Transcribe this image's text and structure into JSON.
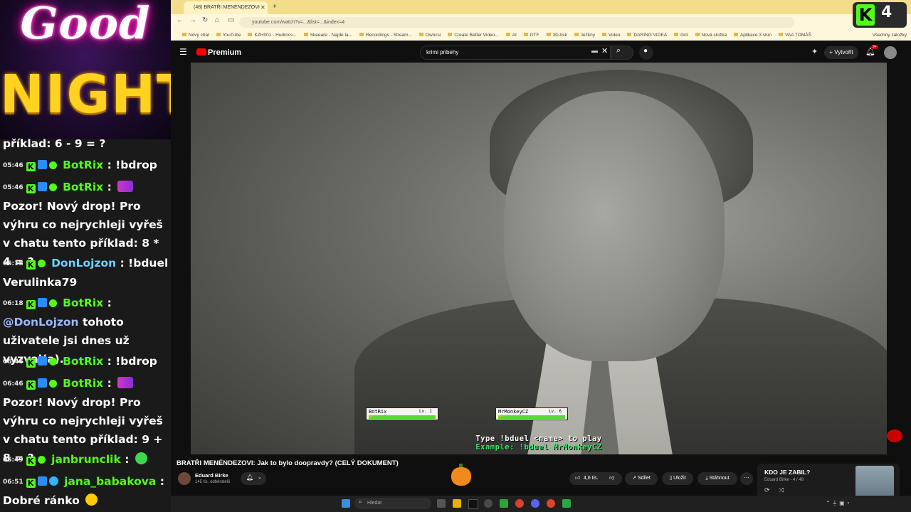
{
  "overlay": {
    "logo_good": "Good",
    "logo_night": "NIGHT",
    "kick_viewers": "4"
  },
  "chat": [
    {
      "time": "",
      "user": "",
      "text": "příklad: 6 - 9 = ?"
    },
    {
      "time": "05:46",
      "user": "BotRix",
      "sep": ":",
      "text": "!bdrop"
    },
    {
      "time": "05:46",
      "user": "BotRix",
      "sep": ":",
      "text": "Pozor! Nový drop! Pro výhru co nejrychleji vyřeš v chatu tento příklad: 8 * 4 = ?"
    },
    {
      "time": "06:18",
      "user": "DonLojzon",
      "sep": ":",
      "text": "!bduel Verulinka79"
    },
    {
      "time": "06:18",
      "user": "BotRix",
      "sep": ":",
      "mention": "@DonLojzon",
      "text": "tohoto uživatele jsi dnes už vyzval(a)."
    },
    {
      "time": "06:46",
      "user": "BotRix",
      "sep": ":",
      "text": "!bdrop"
    },
    {
      "time": "06:46",
      "user": "BotRix",
      "sep": ":",
      "text": "Pozor! Nový drop! Pro výhru co nejrychleji vyřeš v chatu tento příklad: 9 + 8 = ?"
    },
    {
      "time": "06:49",
      "user": "janbrunclik",
      "sep": ":",
      "text": ""
    },
    {
      "time": "06:51",
      "user": "jana_babakova",
      "sep": ":",
      "text": "Dobré ránko"
    }
  ],
  "browser": {
    "tab_title": "(48) BRATŘI MENÉNDEZOVI",
    "url": "youtube.com/watch?v=...&list=...&index=4",
    "bookmarks": [
      "Nový chat",
      "YouTube",
      "KZH001 - Hudrocs...",
      "Skeeare - Najde la...",
      "Recordings - Stream...",
      "Owncsi",
      "Create Better Video...",
      "AI",
      "DTF",
      "3D-tisk",
      "Ježkny",
      "Video",
      "DARING VIDEA",
      "Grit",
      "Nová složka",
      "Aplikace 3 stun",
      "VAA TOMÁŠ"
    ],
    "all_bookmarks": "Všechny záložky"
  },
  "youtube": {
    "brand": "Premium",
    "search_value": "krimi pribehy",
    "create_label": "Vytvořit",
    "notifications": "9+",
    "video_title": "BRATŘI MENÉNDEZOVI: Jak to bylo doopravdy? (CELÝ DOKUMENT)",
    "channel_name": "Eduard Birke",
    "channel_subs": "145 tis. odběratelů",
    "likes": "4,6 tis.",
    "share_label": "Sdílet",
    "save_label": "Uložit",
    "download_label": "Stáhnout",
    "playlist_title": "KDO JE ZABIL?",
    "playlist_sub": "Eduard Birke - 4 / 48"
  },
  "duel": {
    "player1": "BotRix",
    "player1_level": "Lv. 1",
    "player1_hp": 1.0,
    "player2": "MrMonkeyCZ",
    "player2_level": "Lv. 6",
    "player2_hp": 1.0,
    "hp_label": "HP",
    "line1": "Type !bduel <name> to play",
    "line2": "Example: !bduel MrMonkeyCZ"
  },
  "taskbar": {
    "search_placeholder": "Hledat"
  }
}
